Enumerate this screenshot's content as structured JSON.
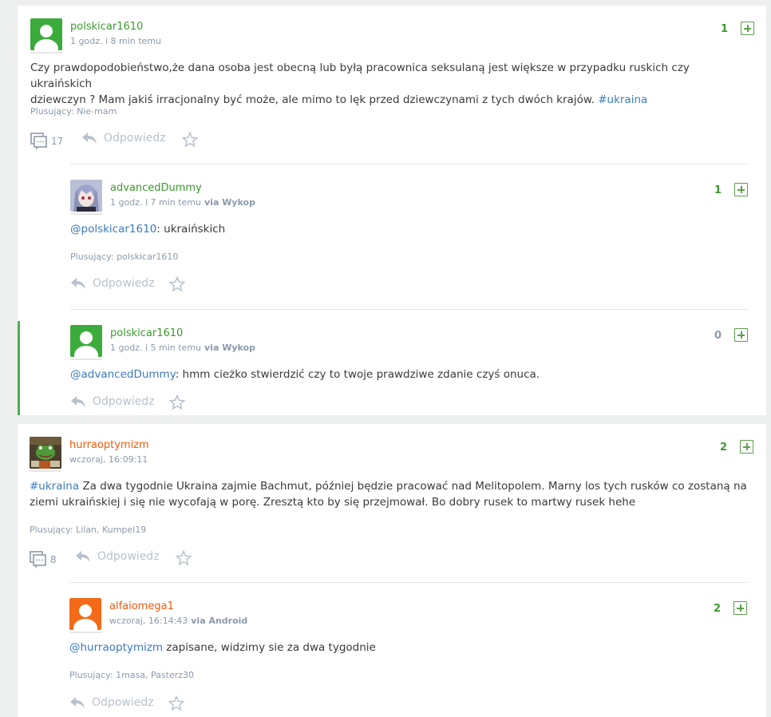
{
  "entries": [
    {
      "author": "polskicar1610",
      "time": "1 godz. i 8 min temu",
      "score": "1",
      "text_before": "Czy prawdopodobieństwo,że dana osoba jest obecną lub byłą pracownica seksulaną jest większe w przypadku ruskich czy ukraińskich",
      "text_line2": "dziewczyn ? Mam jakiś irracjonalny być może, ale mimo to lęk przed dziewczynami z tych dwóch krajów. ",
      "tag": "#ukraina",
      "plusers": "Plusujący: Nie-mam",
      "comments_count": "17",
      "reply_label": "Odpowiedz",
      "comments": [
        {
          "author": "advancedDummy",
          "time": "1 godz. i 7 min temu",
          "via": "via Wykop",
          "score": "1",
          "mention": "@polskicar1610",
          "text": ": ukraińskich",
          "plusers": "Plusujący: polskicar1610",
          "reply_label": "Odpowiedz"
        },
        {
          "author": "polskicar1610",
          "time": "1 godz. i 5 min temu",
          "via": "via Wykop",
          "score": "0",
          "mention": "@advancedDummy",
          "text": ": hmm cieżko stwierdzić czy to twoje prawdziwe zdanie czyś onuca.",
          "reply_label": "Odpowiedz"
        }
      ]
    },
    {
      "author": "hurraoptymizm",
      "time": "wczoraj, 16:09:11",
      "score": "2",
      "tag": "#ukraina",
      "text_line1": " Za dwa tygodnie Ukraina zajmie Bachmut, później będzie pracować nad Melitopolem. Marny los tych rusków co zostaną na",
      "text_line2": "ziemi ukraińskiej i się nie wycofają w porę. Zresztą kto by się przejmował. Bo dobry rusek to martwy rusek hehe",
      "plusers": "Plusujący: Lilan, Kumpel19",
      "comments_count": "8",
      "reply_label": "Odpowiedz",
      "comments": [
        {
          "author": "alfaiomega1",
          "time": "wczoraj, 16:14:43",
          "via": "via Android",
          "score": "2",
          "mention": "@hurraoptymizm",
          "text": " zapisane, widzimy sie za dwa tygodnie",
          "plusers": "Plusujący: 1masa, Pasterz30",
          "reply_label": "Odpowiedz"
        }
      ]
    }
  ],
  "colors": {
    "green": "#3c9a2e",
    "orange": "#f15a0e",
    "link": "#3b7bbf"
  },
  "icons": [
    "user-avatar-icon",
    "plus-vote-icon",
    "comments-icon",
    "reply-icon",
    "star-icon"
  ]
}
